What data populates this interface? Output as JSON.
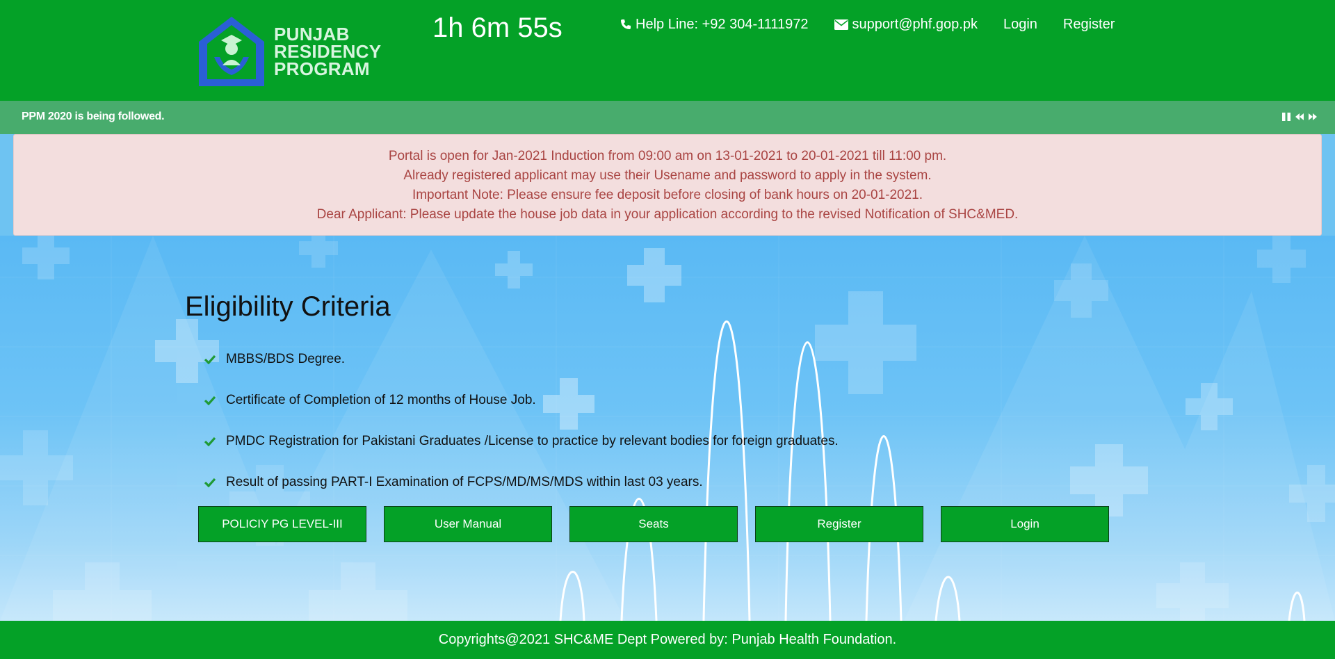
{
  "header": {
    "logo_lines": [
      "PUNJAB",
      "RESIDENCY",
      "PROGRAM"
    ],
    "timer": "1h 6m 55s",
    "helpline": "Help Line: +92 304-1111972",
    "email": "support@phf.gop.pk",
    "login_label": "Login",
    "register_label": "Register"
  },
  "ticker": {
    "text": "PPM 2020 is being followed."
  },
  "alert": {
    "lines": [
      "Portal is open for Jan-2021 Induction from 09:00 am on 13-01-2021 to 20-01-2021 till 11:00 pm.",
      "Already registered applicant may use their Usename and password to apply in the system.",
      "Important Note: Please ensure fee deposit before closing of bank hours on 20-01-2021.",
      "Dear Applicant: Please update the house job data in your application according to the revised Notification of SHC&MED."
    ]
  },
  "main": {
    "title": "Eligibility Criteria",
    "criteria": [
      "MBBS/BDS Degree.",
      "Certificate of Completion of 12 months of House Job.",
      "PMDC Registration for Pakistani Graduates /License to practice by relevant bodies for foreign graduates.",
      "Result of passing PART-I Examination of FCPS/MD/MS/MDS within last 03 years."
    ],
    "buttons": [
      "POLICIY PG LEVEL-III",
      "User Manual",
      "Seats",
      "Register",
      "Login"
    ]
  },
  "footer": {
    "text": "Copyrights@2021 SHC&ME Dept Powered by: Punjab Health Foundation."
  },
  "colors": {
    "brand_green": "#04a127",
    "ticker_green": "#48ac6d",
    "alert_bg": "#f3dede",
    "alert_text": "#a94442",
    "check_green": "#1f9a35"
  },
  "icons": [
    "logo-icon",
    "phone-icon",
    "envelope-icon",
    "pause-icon",
    "backward-icon",
    "forward-icon",
    "check-icon"
  ]
}
